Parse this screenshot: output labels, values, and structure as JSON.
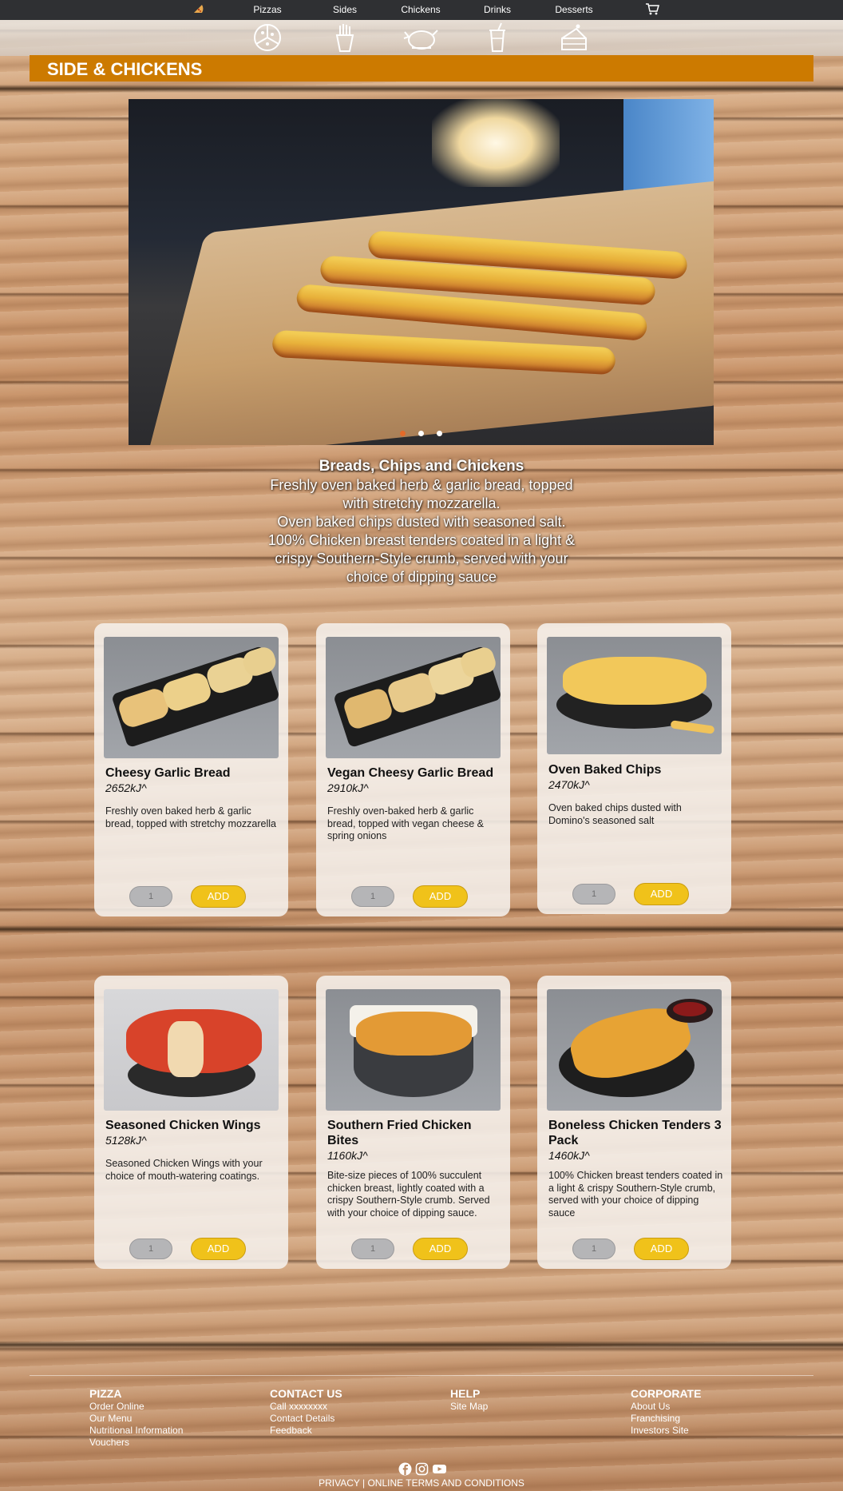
{
  "nav": {
    "logo_icon": "pizza-slice-icon",
    "items": [
      {
        "label": "Pizzas",
        "icon": "pizza-icon"
      },
      {
        "label": "Sides",
        "icon": "fries-icon"
      },
      {
        "label": "Chickens",
        "icon": "chicken-icon"
      },
      {
        "label": "Drinks",
        "icon": "drink-cup-icon"
      },
      {
        "label": "Desserts",
        "icon": "cake-icon"
      }
    ],
    "cart_icon": "cart-icon"
  },
  "banner": {
    "title": "SIDE & CHICKENS",
    "color": "#cc7a00"
  },
  "hero": {
    "image": "garlic-bread-tray-in-oven",
    "slides": 3,
    "active_slide": 1,
    "caption_title": "Breads, Chips and Chickens",
    "caption_lines": [
      "Freshly oven baked herb & garlic bread, topped",
      "with stretchy mozzarella.",
      "Oven baked chips dusted with seasoned salt.",
      "100% Chicken breast tenders coated in a light &",
      "crispy Southern-Style crumb, served with your",
      "choice of dipping sauce"
    ]
  },
  "products": [
    {
      "name": "Cheesy Garlic Bread",
      "energy": "2652kJ^",
      "desc": "Freshly oven baked herb & garlic bread, topped with stretchy mozzarella",
      "qty": "1",
      "add_label": "ADD",
      "image": "cheesy-garlic-bread"
    },
    {
      "name": "Vegan Cheesy Garlic Bread",
      "energy": "2910kJ^",
      "desc": "Freshly oven-baked herb & garlic bread, topped with vegan cheese & spring onions",
      "qty": "1",
      "add_label": "ADD",
      "image": "vegan-cheesy-garlic-bread"
    },
    {
      "name": "Oven Baked Chips",
      "energy": "2470kJ^",
      "desc": "Oven baked chips dusted with Domino's seasoned salt",
      "qty": "1",
      "add_label": "ADD",
      "image": "oven-baked-chips"
    },
    {
      "name": "Seasoned Chicken Wings",
      "energy": "5128kJ^",
      "desc": "Seasoned Chicken Wings with your choice of mouth-watering coatings.",
      "qty": "1",
      "add_label": "ADD",
      "image": "seasoned-chicken-wings"
    },
    {
      "name": "Southern Fried Chicken Bites",
      "energy": "1160kJ^",
      "desc": "Bite-size pieces of 100% succulent chicken breast, lightly coated with a crispy Southern-Style crumb. Served with your choice of dipping sauce.",
      "qty": "1",
      "add_label": "ADD",
      "image": "southern-fried-chicken-bites"
    },
    {
      "name": "Boneless Chicken Tenders 3 Pack",
      "energy": "1460kJ^",
      "desc": "100% Chicken breast tenders coated in a light & crispy Southern-Style crumb, served with your choice of dipping sauce",
      "qty": "1",
      "add_label": "ADD",
      "image": "boneless-chicken-tenders"
    }
  ],
  "footer": {
    "columns": [
      {
        "heading": "PIZZA",
        "links": [
          "Order Online",
          "Our Menu",
          "Nutritional Information",
          "Vouchers"
        ]
      },
      {
        "heading": "CONTACT US",
        "links": [
          "Call xxxxxxxx",
          "Contact Details",
          "Feedback"
        ]
      },
      {
        "heading": "HELP",
        "links": [
          "Site Map"
        ]
      },
      {
        "heading": "CORPORATE",
        "links": [
          "About Us",
          "Franchising",
          "Investors Site"
        ]
      }
    ],
    "social_icons": [
      "facebook-icon",
      "instagram-icon",
      "youtube-icon"
    ],
    "legal": "PRIVACY | ONLINE TERMS AND CONDITIONS"
  },
  "colors": {
    "accent": "#f0c21a",
    "nav_bg": "#2f3033",
    "banner": "#cc7a00"
  }
}
